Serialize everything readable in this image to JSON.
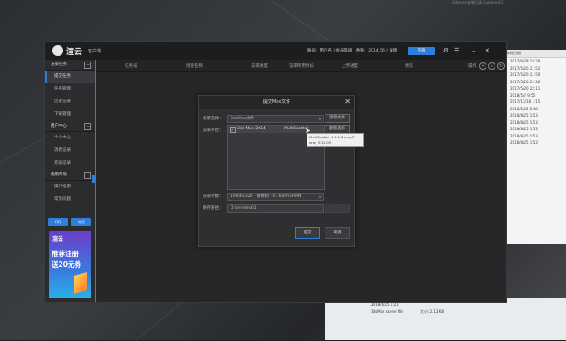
{
  "desktop": {
    "top_status": "3dsmax 安装目录 [Autodesk]",
    "explorer_header": "修改日期",
    "explorer_rows": [
      "2017/6/28 13:28",
      "2017/5/20 21:52",
      "2017/5/20 21:50",
      "2017/5/20 22:30",
      "2017/5/20 22:11",
      "2018/5/7 9:55",
      "2017/12/18 1:15",
      "2018/5/25 5:48",
      "2018/8/25 1:53",
      "2018/8/25 1:53",
      "2018/8/25 1:53",
      "2018/8/25 1:53",
      "2018/8/25 1:53"
    ],
    "file_name": "3dsMax scene file",
    "file_size": "大小: 2.12 KB",
    "file_date": "2018/8/25 1:21"
  },
  "app": {
    "logo": "渲云",
    "logo_sub": "客户端",
    "user_info": "账号：用户名 | 会员等级 | 余额：2014.56 | 详情",
    "recharge": "充值",
    "sidebar": {
      "section1": "渲染任务",
      "items1": [
        "提交任务",
        "任务管理",
        "历史记录",
        "下载管理"
      ],
      "section2": "用户中心",
      "items2": [
        "个人中心",
        "消费记录",
        "充值记录"
      ],
      "section3": "使用帮助",
      "items3": [
        "操作指南",
        "常见问题"
      ],
      "btn_qq": "QQ",
      "btn_phone": "电话",
      "ad_logo": "渲云",
      "ad_line1": "推荐注册",
      "ad_line2": "送20元券"
    },
    "columns": [
      "任务号",
      "场景名称",
      "渲染进度",
      "渲染所用时长",
      "上传进度",
      "状态",
      "操作"
    ]
  },
  "dialog": {
    "title": "提交Max文件",
    "label_scene": "场景选择：",
    "scene_value": "3dsMax文件",
    "btn_add": "添加文件",
    "label_plugin": "渲染平台：",
    "plugin_item_max": "3ds Max 2014",
    "plugin_item_multi": "MultiScatter",
    "btn_remove": "删除选择",
    "label_res": "渲染参数：",
    "res_value": "1944/2320 · 摄像机 · 0.160m/vRMN",
    "label_path": "保存路径：",
    "path_value": "D:\\render\\01",
    "btn_ok": "提交",
    "btn_cancel": "取消",
    "tooltip_line1": "MultiScatter 1.6.1.6 vray3",
    "tooltip_line2": "vray 3.20.03"
  },
  "colors": {
    "accent": "#2d7fd9",
    "window_bg": "#262729",
    "dialog_bg": "#2e2f31"
  }
}
